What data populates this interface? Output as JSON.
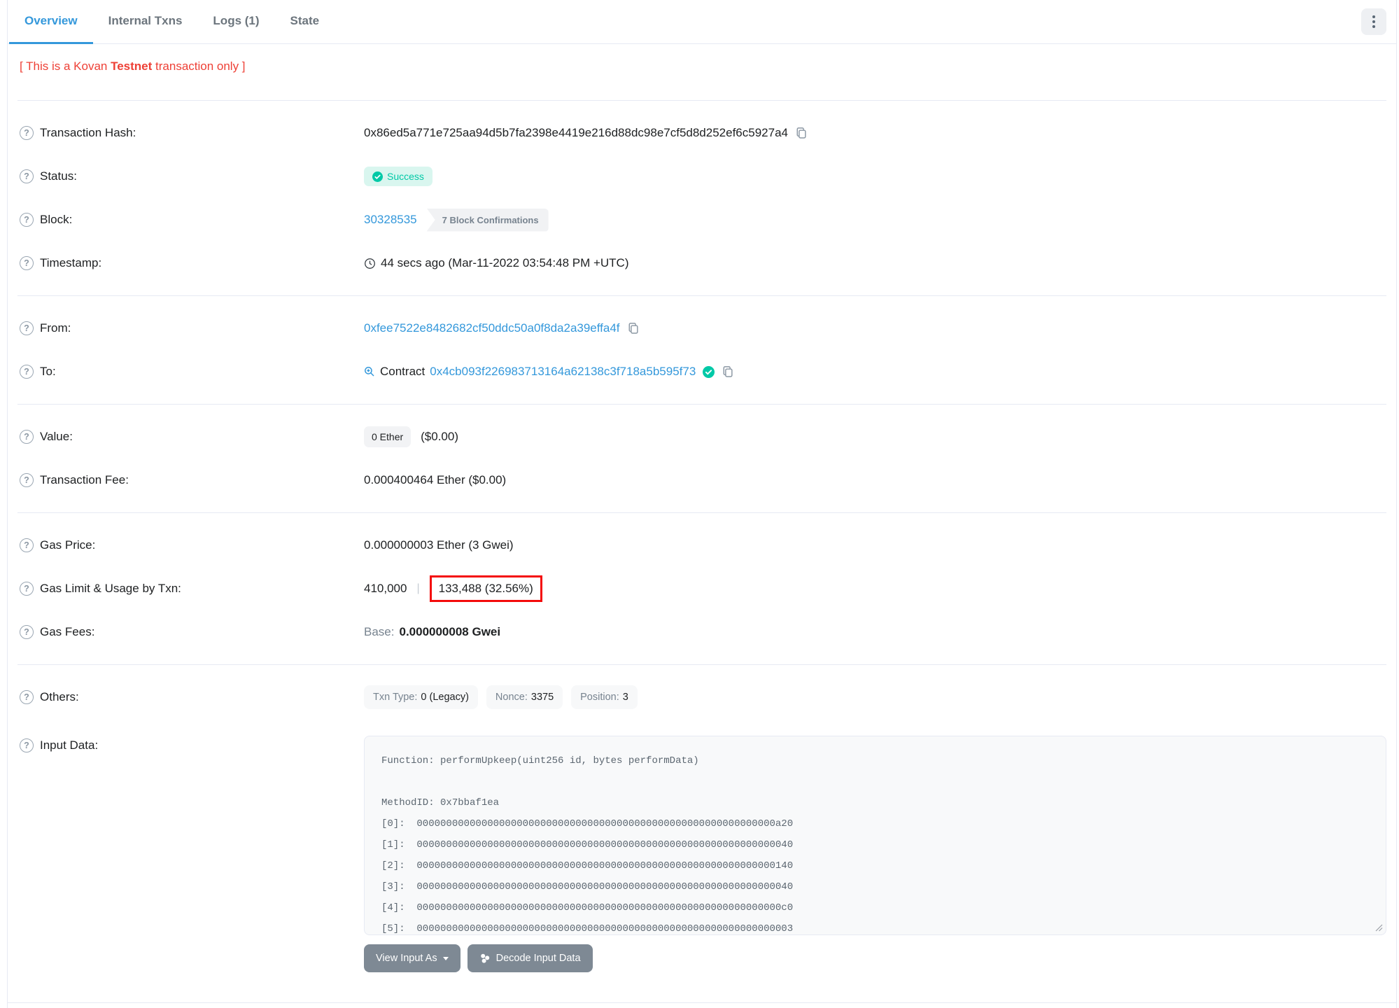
{
  "tabs": {
    "items": [
      {
        "label": "Overview",
        "active": true
      },
      {
        "label": "Internal Txns",
        "active": false
      },
      {
        "label": "Logs (1)",
        "active": false
      },
      {
        "label": "State",
        "active": false
      }
    ]
  },
  "warning": {
    "part1": "[ This is a Kovan ",
    "part2": "Testnet",
    "part3": " transaction only ]"
  },
  "rows": {
    "transaction_hash": {
      "label": "Transaction Hash:",
      "value": "0x86ed5a771e725aa94d5b7fa2398e4419e216d88dc98e7cf5d8d252ef6c5927a4"
    },
    "status": {
      "label": "Status:",
      "badge": "Success"
    },
    "block": {
      "label": "Block:",
      "number": "30328535",
      "confirmations": "7 Block Confirmations"
    },
    "timestamp": {
      "label": "Timestamp:",
      "value": "44 secs ago (Mar-11-2022 03:54:48 PM +UTC)"
    },
    "from": {
      "label": "From:",
      "address": "0xfee7522e8482682cf50ddc50a0f8da2a39effa4f"
    },
    "to": {
      "label": "To:",
      "prefix": "Contract",
      "address": "0x4cb093f226983713164a62138c3f718a5b595f73"
    },
    "value": {
      "label": "Value:",
      "badge": "0 Ether",
      "usd": "($0.00)"
    },
    "transaction_fee": {
      "label": "Transaction Fee:",
      "value": "0.000400464 Ether ($0.00)"
    },
    "gas_price": {
      "label": "Gas Price:",
      "value": "0.000000003 Ether (3 Gwei)"
    },
    "gas_limit_usage": {
      "label": "Gas Limit & Usage by Txn:",
      "limit": "410,000",
      "separator": "|",
      "usage": "133,488 (32.56%)"
    },
    "gas_fees": {
      "label": "Gas Fees:",
      "base_label": "Base:",
      "base_value": "0.000000008 Gwei"
    },
    "others": {
      "label": "Others:",
      "badges": [
        {
          "name": "Txn Type:",
          "value": "0 (Legacy)"
        },
        {
          "name": "Nonce:",
          "value": "3375"
        },
        {
          "name": "Position:",
          "value": "3"
        }
      ]
    },
    "input_data": {
      "label": "Input Data:",
      "text": "Function: performUpkeep(uint256 id, bytes performData)\n\nMethodID: 0x7bbaf1ea\n[0]:  0000000000000000000000000000000000000000000000000000000000000a20\n[1]:  0000000000000000000000000000000000000000000000000000000000000040\n[2]:  0000000000000000000000000000000000000000000000000000000000000140\n[3]:  0000000000000000000000000000000000000000000000000000000000000040\n[4]:  00000000000000000000000000000000000000000000000000000000000000c0\n[5]:  0000000000000000000000000000000000000000000000000000000000000003",
      "view_button": "View Input As",
      "decode_button": "Decode Input Data"
    }
  },
  "colors": {
    "accent_blue": "#3498db",
    "success_teal": "#00c9a7",
    "danger_red": "#ee4036",
    "annotation_red": "#f40b0b",
    "muted_gray": "#77838f"
  }
}
